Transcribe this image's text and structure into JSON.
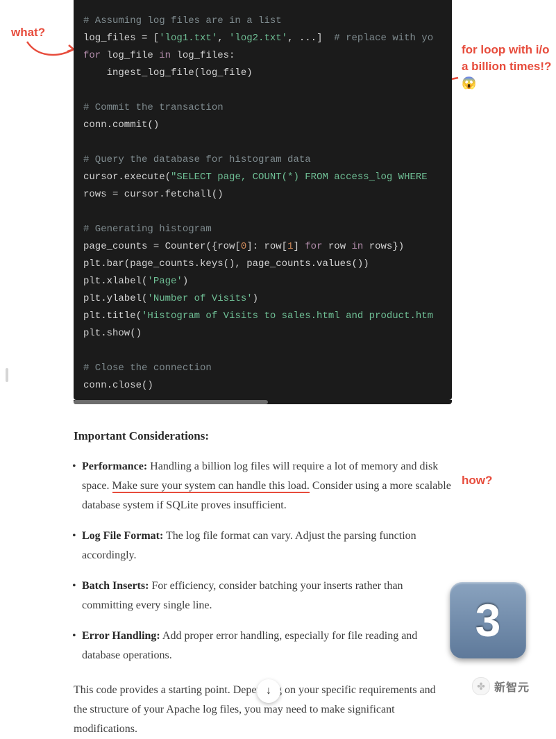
{
  "annotations": {
    "what": "what?",
    "loop": "for loop with i/o a billion times!? 😱",
    "how": "how?"
  },
  "code": {
    "lines": [
      {
        "tokens": [
          {
            "t": "# Assuming log files are in a list",
            "c": "tok-comment"
          }
        ]
      },
      {
        "tokens": [
          {
            "t": "log_files = ["
          },
          {
            "t": "'log1.txt'",
            "c": "tok-str"
          },
          {
            "t": ", "
          },
          {
            "t": "'log2.txt'",
            "c": "tok-str"
          },
          {
            "t": ", ...]  "
          },
          {
            "t": "# replace with yo",
            "c": "tok-comment"
          }
        ]
      },
      {
        "tokens": [
          {
            "t": "for",
            "c": "tok-key"
          },
          {
            "t": " log_file "
          },
          {
            "t": "in",
            "c": "tok-key"
          },
          {
            "t": " log_files:"
          }
        ]
      },
      {
        "tokens": [
          {
            "t": "    ingest_log_file(log_file)"
          }
        ]
      },
      {
        "tokens": [
          {
            "t": " "
          }
        ]
      },
      {
        "tokens": [
          {
            "t": "# Commit the transaction",
            "c": "tok-comment"
          }
        ]
      },
      {
        "tokens": [
          {
            "t": "conn.commit()"
          }
        ]
      },
      {
        "tokens": [
          {
            "t": " "
          }
        ]
      },
      {
        "tokens": [
          {
            "t": "# Query the database for histogram data",
            "c": "tok-comment"
          }
        ]
      },
      {
        "tokens": [
          {
            "t": "cursor.execute("
          },
          {
            "t": "\"SELECT page, COUNT(*) FROM access_log WHERE ",
            "c": "tok-sql"
          }
        ]
      },
      {
        "tokens": [
          {
            "t": "rows = cursor.fetchall()"
          }
        ]
      },
      {
        "tokens": [
          {
            "t": " "
          }
        ]
      },
      {
        "tokens": [
          {
            "t": "# Generating histogram",
            "c": "tok-comment"
          }
        ]
      },
      {
        "tokens": [
          {
            "t": "page_counts = Counter({row["
          },
          {
            "t": "0",
            "c": "tok-num"
          },
          {
            "t": "]: row["
          },
          {
            "t": "1",
            "c": "tok-num"
          },
          {
            "t": "] "
          },
          {
            "t": "for",
            "c": "tok-key"
          },
          {
            "t": " row "
          },
          {
            "t": "in",
            "c": "tok-key"
          },
          {
            "t": " rows})"
          }
        ]
      },
      {
        "tokens": [
          {
            "t": "plt.bar(page_counts.keys(), page_counts.values())"
          }
        ]
      },
      {
        "tokens": [
          {
            "t": "plt.xlabel("
          },
          {
            "t": "'Page'",
            "c": "tok-str"
          },
          {
            "t": ")"
          }
        ]
      },
      {
        "tokens": [
          {
            "t": "plt.ylabel("
          },
          {
            "t": "'Number of Visits'",
            "c": "tok-str"
          },
          {
            "t": ")"
          }
        ]
      },
      {
        "tokens": [
          {
            "t": "plt.title("
          },
          {
            "t": "'Histogram of Visits to sales.html and product.htm",
            "c": "tok-str"
          }
        ]
      },
      {
        "tokens": [
          {
            "t": "plt.show()"
          }
        ]
      },
      {
        "tokens": [
          {
            "t": " "
          }
        ]
      },
      {
        "tokens": [
          {
            "t": "# Close the connection",
            "c": "tok-comment"
          }
        ]
      },
      {
        "tokens": [
          {
            "t": "conn.close()"
          }
        ]
      }
    ]
  },
  "heading": "Important Considerations:",
  "bullets": [
    {
      "label": "Performance:",
      "pre": " Handling a billion log files will require a lot of memory and disk space. ",
      "highlight": "Make sure your system can handle this load.",
      "post": " Consider using a more scalable database system if SQLite proves insufficient."
    },
    {
      "label": "Log File Format:",
      "pre": " The log file format can vary. Adjust the parsing function accordingly.",
      "highlight": "",
      "post": ""
    },
    {
      "label": "Batch Inserts:",
      "pre": " For efficiency, consider batching your inserts rather than committing every single line.",
      "highlight": "",
      "post": ""
    },
    {
      "label": "Error Handling:",
      "pre": " Add proper error handling, especially for file reading and database operations.",
      "highlight": "",
      "post": ""
    }
  ],
  "summary": "This code provides a starting point. Depending on your specific requirements and the structure of your Apache log files, you may need to make significant modifications.",
  "badge": "3",
  "down_arrow": "↓",
  "watermark": {
    "icon": "✤",
    "text": "新智元"
  }
}
